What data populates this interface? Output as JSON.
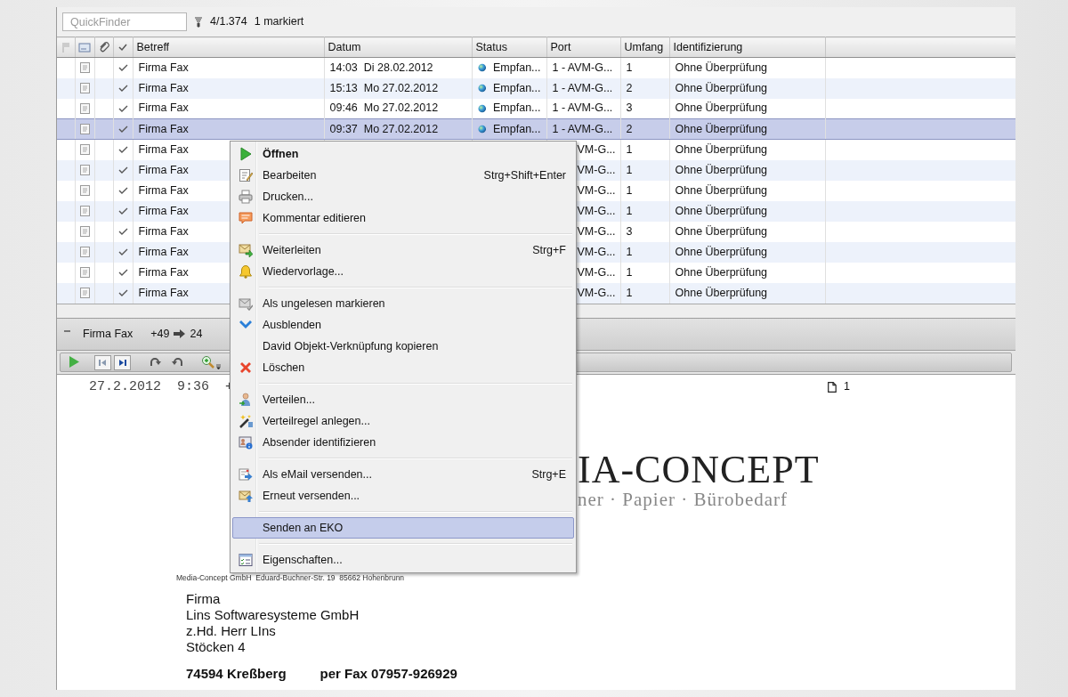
{
  "toolbar": {
    "search": {
      "placeholder": "QuickFinder"
    },
    "count": "4/1.374",
    "marked": "1 markiert"
  },
  "table": {
    "columns": [
      "Betreff",
      "Datum",
      "Status",
      "Port",
      "Umfang",
      "Identifizierung"
    ],
    "rows": [
      {
        "selected": false,
        "done": true,
        "subject": "Firma Fax",
        "date": "14:03  Di 28.02.2012",
        "status": "Empfan...",
        "port": "1 - AVM-G...",
        "pages": "1",
        "identification": "Ohne Überprüfung"
      },
      {
        "selected": false,
        "done": true,
        "subject": "Firma Fax",
        "date": "15:13  Mo 27.02.2012",
        "status": "Empfan...",
        "port": "1 - AVM-G...",
        "pages": "2",
        "identification": "Ohne Überprüfung"
      },
      {
        "selected": false,
        "done": true,
        "subject": "Firma Fax",
        "date": "09:46  Mo 27.02.2012",
        "status": "Empfan...",
        "port": "1 - AVM-G...",
        "pages": "3",
        "identification": "Ohne Überprüfung"
      },
      {
        "selected": true,
        "done": true,
        "subject": "Firma Fax",
        "date": "09:37  Mo 27.02.2012",
        "status": "Empfan...",
        "port": "1 - AVM-G...",
        "pages": "2",
        "identification": "Ohne Überprüfung"
      },
      {
        "selected": false,
        "done": true,
        "subject": "Firma Fax",
        "port": "VM-G...",
        "pages": "1",
        "identification": "Ohne Überprüfung"
      },
      {
        "selected": false,
        "done": true,
        "subject": "Firma Fax",
        "port": "VM-G...",
        "pages": "1",
        "identification": "Ohne Überprüfung"
      },
      {
        "selected": false,
        "done": true,
        "subject": "Firma Fax",
        "port": "VM-G...",
        "pages": "1",
        "identification": "Ohne Überprüfung"
      },
      {
        "selected": false,
        "done": true,
        "subject": "Firma Fax",
        "port": "VM-G...",
        "pages": "1",
        "identification": "Ohne Überprüfung"
      },
      {
        "selected": false,
        "done": true,
        "subject": "Firma Fax",
        "port": "VM-G...",
        "pages": "3",
        "identification": "Ohne Überprüfung"
      },
      {
        "selected": false,
        "done": true,
        "subject": "Firma Fax",
        "port": "VM-G...",
        "pages": "1",
        "identification": "Ohne Überprüfung"
      },
      {
        "selected": false,
        "done": true,
        "subject": "Firma Fax",
        "port": "VM-G...",
        "pages": "1",
        "identification": "Ohne Überprüfung"
      },
      {
        "selected": false,
        "done": true,
        "subject": "Firma Fax",
        "port": "VM-G...",
        "pages": "1",
        "identification": "Ohne Überprüfung"
      }
    ]
  },
  "preview": {
    "sender": "Firma Fax",
    "from": "+49",
    "to": "24",
    "document": {
      "header": "27.2.2012  9:36  +",
      "pages": "1",
      "logo": "IA-CONCEPT",
      "tagline": "ner · Papier · Bürobedarf",
      "sender_line": "Media-Concept GmbH  Eduard-Buchner-Str. 19  85662 Hohenbrunn",
      "recipient": [
        "Firma",
        "Lins Softwaresysteme GmbH",
        "z.Hd. Herr LIns",
        "Stöcken 4"
      ],
      "city": "74594 Kreßberg",
      "fax": "per Fax 07957-926929"
    }
  },
  "context_menu": {
    "sections": [
      [
        {
          "kind": "play",
          "label": "Öffnen",
          "default": true,
          "selected": false
        },
        {
          "kind": "edit",
          "label": "Bearbeiten",
          "shortcut": "Strg+Shift+Enter",
          "default": false,
          "selected": false
        },
        {
          "kind": "print",
          "label": "Drucken...",
          "default": false,
          "selected": false
        },
        {
          "kind": "comment",
          "label": "Kommentar editieren",
          "default": false,
          "selected": false
        }
      ],
      [
        {
          "kind": "forward",
          "label": "Weiterleiten",
          "shortcut": "Strg+F",
          "default": false,
          "selected": false
        },
        {
          "kind": "bell",
          "label": "Wiedervorlage...",
          "default": false,
          "selected": false
        }
      ],
      [
        {
          "kind": "mailgray",
          "label": "Als ungelesen markieren",
          "default": false,
          "selected": false
        },
        {
          "kind": "chevron",
          "label": "Ausblenden",
          "default": false,
          "selected": false
        },
        {
          "kind": "plain",
          "label": "David Objekt-Verknüpfung kopieren",
          "default": false,
          "selected": false
        },
        {
          "kind": "delete",
          "label": "Löschen",
          "default": false,
          "selected": false
        }
      ],
      [
        {
          "kind": "person",
          "label": "Verteilen...",
          "default": false,
          "selected": false
        },
        {
          "kind": "wand",
          "label": "Verteilregel anlegen...",
          "default": false,
          "selected": false
        },
        {
          "kind": "contact",
          "label": "Absender identifizieren",
          "default": false,
          "selected": false
        }
      ],
      [
        {
          "kind": "send",
          "label": "Als eMail versenden...",
          "shortcut": "Strg+E",
          "default": false,
          "selected": false
        },
        {
          "kind": "mailup",
          "label": "Erneut versenden...",
          "default": false,
          "selected": false
        }
      ],
      [
        {
          "kind": "plain",
          "label": "Senden an EKO",
          "default": false,
          "selected": true
        }
      ],
      [
        {
          "kind": "props",
          "label": "Eigenschaften...",
          "default": false,
          "selected": false
        }
      ]
    ]
  }
}
